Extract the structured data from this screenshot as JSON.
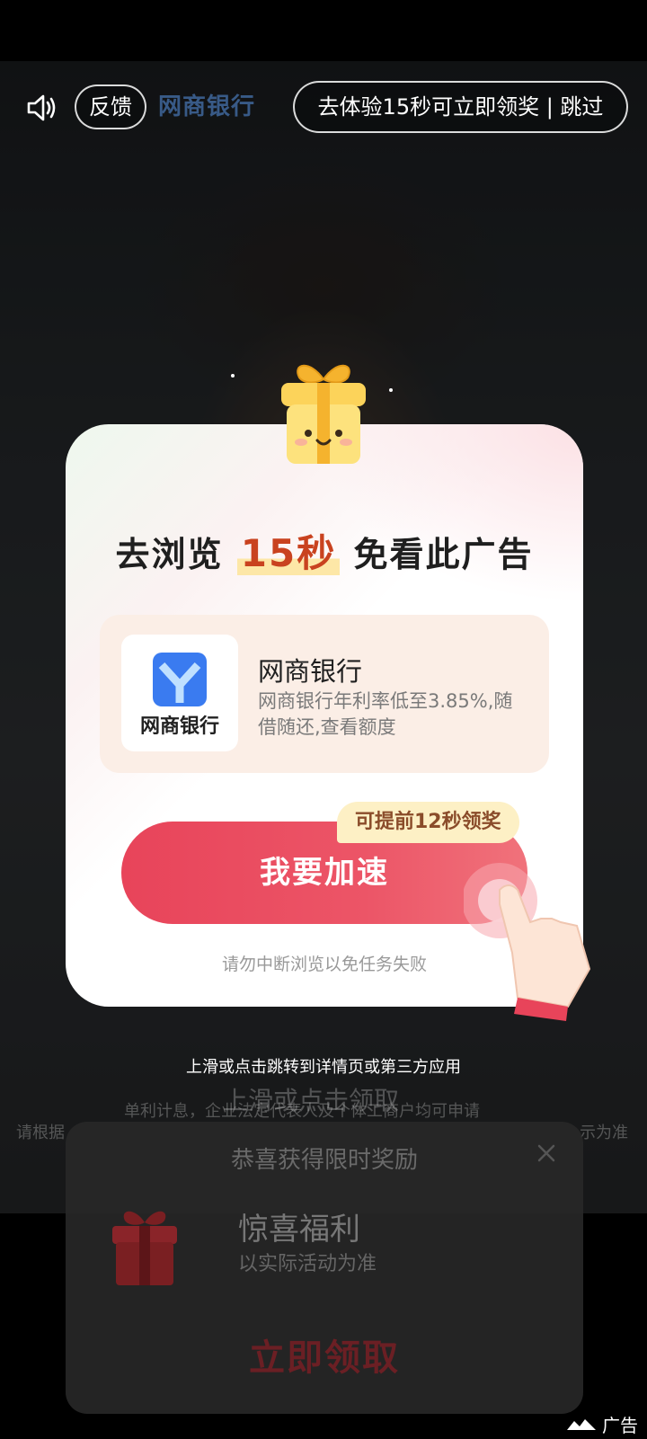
{
  "topbar": {
    "feedback_label": "反馈",
    "brand_text": "网商银行",
    "skip_label": "去体验15秒可立即领奖 | 跳过"
  },
  "modal": {
    "title_prefix": "去浏览 ",
    "title_highlight": "15秒",
    "title_suffix": " 免看此广告",
    "app": {
      "name": "网商银行",
      "logo_text": "网商银行",
      "description": "网商银行年利率低至3.85%,随借随还,查看额度"
    },
    "badge": "可提前12秒领奖",
    "speed_button": "我要加速",
    "hint": "请勿中断浏览以免任务失败"
  },
  "swipe_hint": "上滑或点击跳转到详情页或第三方应用",
  "background_text": {
    "overlay_cta": "上滑或点击领取",
    "disclaimer_1": "单利计息，企业法定代表人及个体工商户均可申请",
    "disclaimer_2": "请根据",
    "disclaimer_3": "示为准"
  },
  "bottom_card": {
    "title": "恭喜获得限时奖励",
    "name": "惊喜福利",
    "subtitle": "以实际活动为准",
    "claim_label": "立即领取"
  },
  "ad_tag": "广告",
  "colors": {
    "accent_red": "#e8445a",
    "highlight_orange": "#c9421f",
    "badge_bg": "#fdf0c5",
    "logo_blue": "#3a7bf0"
  }
}
